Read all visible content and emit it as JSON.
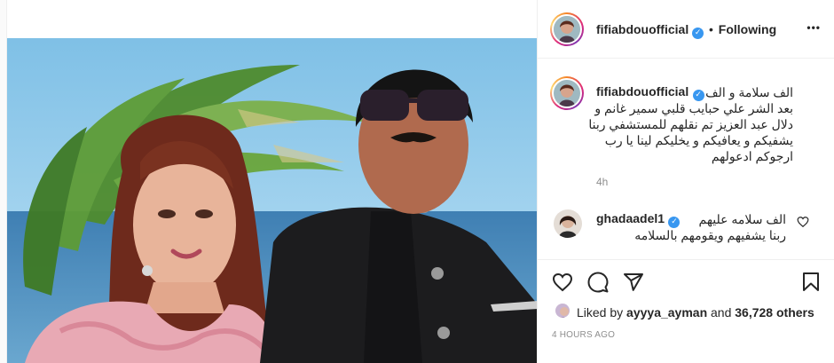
{
  "header": {
    "username": "fifiabdouofficial",
    "separator": "•",
    "follow_status": "Following",
    "more_glyph": "•••"
  },
  "caption": {
    "username": "fifiabdouofficial",
    "lines": [
      "الف سلامة و الف",
      "بعد الشر علي حبايب قلبي سمير غانم و",
      "دلال عبد العزيز تم نقلهم للمستشفي ربنا",
      "يشفيكم و يعافيكم و يخليكم لينا يا رب",
      "ارجوكم ادعولهم"
    ],
    "time": "4h"
  },
  "comment": {
    "username": "ghadaadel1",
    "lines": [
      "الف سلامه عليهم",
      "ربنا يشفيهم ويقومهم بالسلامه"
    ]
  },
  "likes": {
    "prefix": "Liked by",
    "user": "ayyya_ayman",
    "joiner": "and",
    "others": "36,728 others"
  },
  "timestamp": "4 HOURS AGO",
  "icons": {
    "verified": "verified-badge-icon",
    "more": "more-options-icon",
    "like": "heart-icon",
    "comment": "comment-icon",
    "share": "share-icon",
    "save": "bookmark-icon",
    "comment_like": "small-heart-icon"
  },
  "colors": {
    "verified": "#3897f0",
    "muted": "#8e8e8e",
    "text": "#262626",
    "border": "#efefef"
  }
}
